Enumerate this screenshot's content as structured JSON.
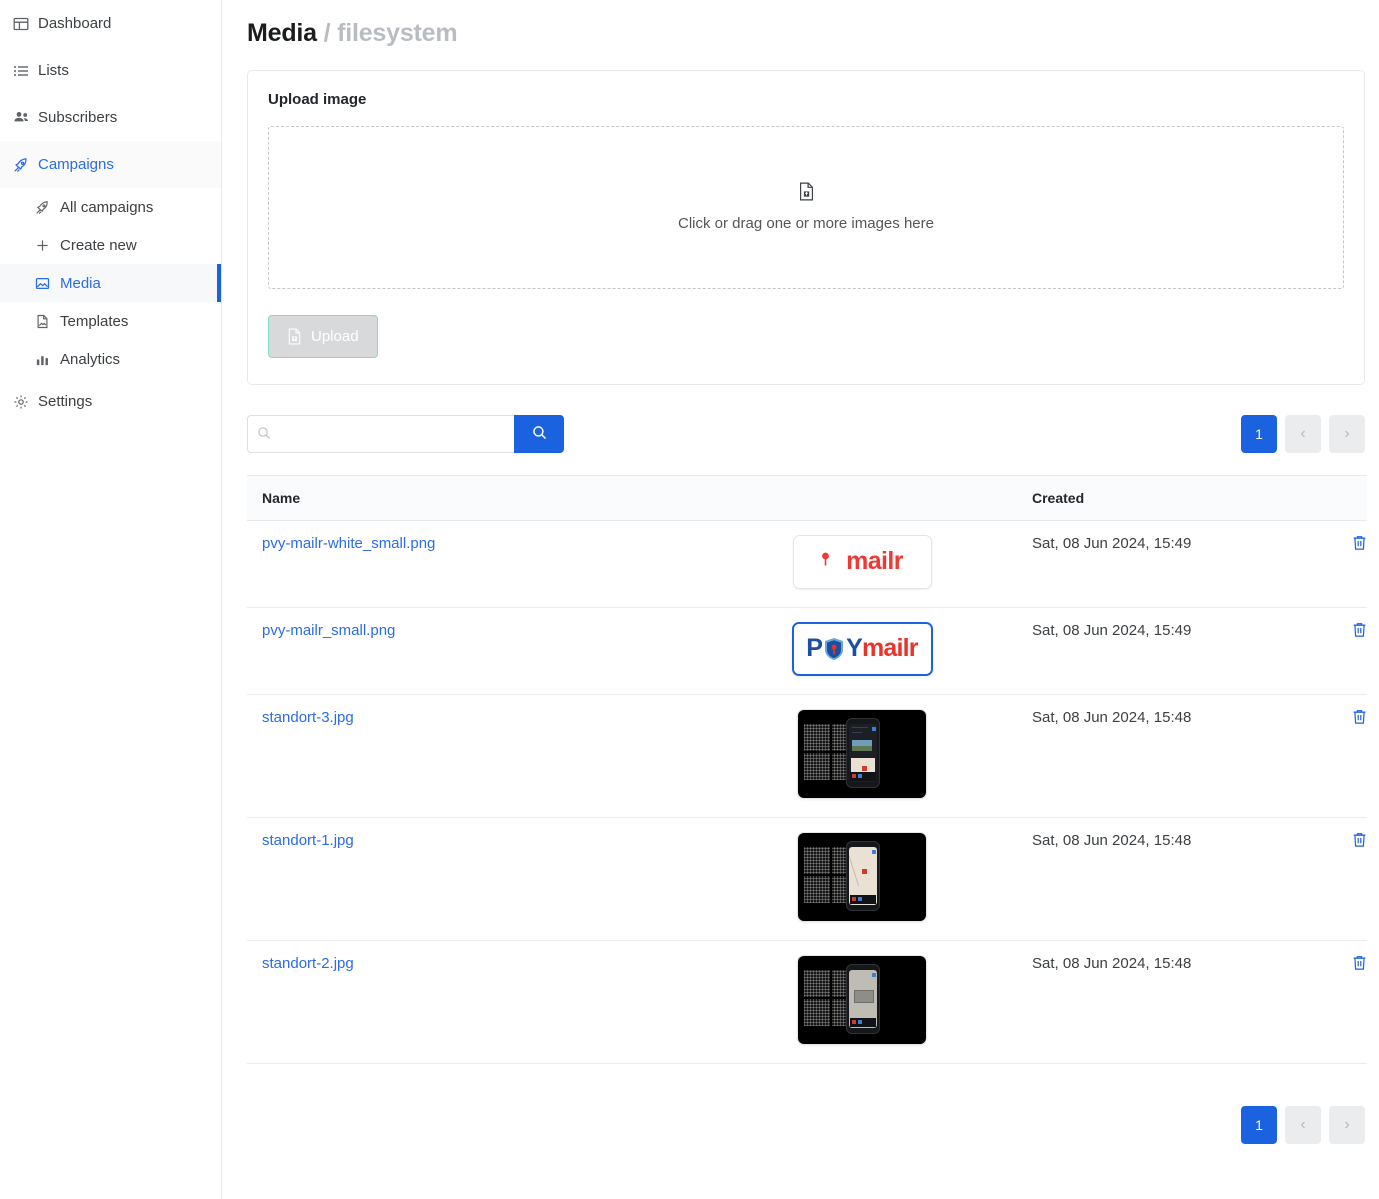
{
  "sidebar": {
    "items": [
      {
        "label": "Dashboard",
        "icon": "dashboard-icon"
      },
      {
        "label": "Lists",
        "icon": "list-icon"
      },
      {
        "label": "Subscribers",
        "icon": "people-icon"
      },
      {
        "label": "Campaigns",
        "icon": "rocket-icon",
        "active": true
      },
      {
        "label": "Settings",
        "icon": "gear-icon"
      }
    ],
    "subitems": [
      {
        "label": "All campaigns",
        "icon": "rocket-icon"
      },
      {
        "label": "Create new",
        "icon": "plus-icon"
      },
      {
        "label": "Media",
        "icon": "image-icon",
        "current": true
      },
      {
        "label": "Templates",
        "icon": "file-image-icon"
      },
      {
        "label": "Analytics",
        "icon": "bar-chart-icon"
      }
    ]
  },
  "header": {
    "title": "Media",
    "separator": "/",
    "subtitle": "filesystem"
  },
  "upload": {
    "card_title": "Upload image",
    "dropzone_text": "Click or drag one or more images here",
    "dropzone_icon": "file-upload-icon",
    "button_label": "Upload",
    "button_icon": "file-upload-icon",
    "button_border_color": "#7fdcc8",
    "button_background": "#d8d9da"
  },
  "toolbar": {
    "search_value": "",
    "search_placeholder": "",
    "search_icon": "search-icon",
    "search_button_icon": "search-icon",
    "search_button_color": "#1a62e0"
  },
  "pagination": {
    "current_page": "1",
    "prev_label": "‹",
    "next_label": "›",
    "active_color": "#1a62e0"
  },
  "table": {
    "columns": [
      "Name",
      "",
      "Created",
      ""
    ],
    "rows": [
      {
        "name": "pvy-mailr-white_small.png",
        "created": "Sat, 08 Jun 2024, 15:49",
        "thumb_kind": "logo-white",
        "thumb_focused": false,
        "thumb_text": "mailr",
        "delete_icon": "trash-icon"
      },
      {
        "name": "pvy-mailr_small.png",
        "created": "Sat, 08 Jun 2024, 15:49",
        "thumb_kind": "logo-color",
        "thumb_focused": true,
        "thumb_text": "PVYmailr",
        "delete_icon": "trash-icon"
      },
      {
        "name": "standort-3.jpg",
        "created": "Sat, 08 Jun 2024, 15:48",
        "thumb_kind": "photo-dark",
        "thumb_focused": false,
        "thumb_text": "",
        "delete_icon": "trash-icon"
      },
      {
        "name": "standort-1.jpg",
        "created": "Sat, 08 Jun 2024, 15:48",
        "thumb_kind": "photo-map",
        "thumb_focused": false,
        "thumb_text": "",
        "delete_icon": "trash-icon"
      },
      {
        "name": "standort-2.jpg",
        "created": "Sat, 08 Jun 2024, 15:48",
        "thumb_kind": "photo-gray",
        "thumb_focused": false,
        "thumb_text": "",
        "delete_icon": "trash-icon"
      }
    ]
  }
}
